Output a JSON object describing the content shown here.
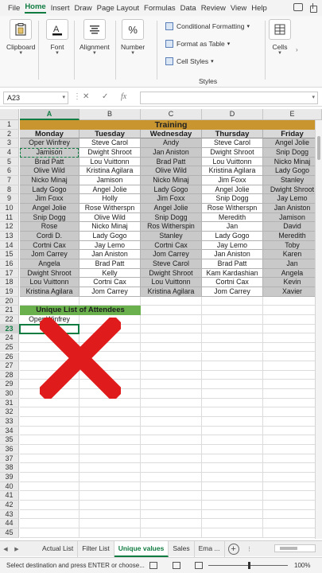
{
  "menu": [
    "File",
    "Home",
    "Insert",
    "Draw",
    "Page Layout",
    "Formulas",
    "Data",
    "Review",
    "View",
    "Help"
  ],
  "menu_active": "Home",
  "ribbon": {
    "clipboard": "Clipboard",
    "font": "Font",
    "alignment": "Alignment",
    "number": "Number",
    "conditional_formatting": "Conditional Formatting",
    "format_as_table": "Format as Table",
    "cell_styles": "Cell Styles",
    "styles": "Styles",
    "cells": "Cells",
    "number_symbol": "%"
  },
  "formula_bar": {
    "name_box": "A23",
    "fx": "fx",
    "value": ""
  },
  "columns": [
    "A",
    "B",
    "C",
    "D",
    "E"
  ],
  "rows": [
    "1",
    "2",
    "3",
    "4",
    "5",
    "6",
    "7",
    "8",
    "9",
    "10",
    "11",
    "12",
    "13",
    "14",
    "15",
    "16",
    "17",
    "18",
    "19",
    "20",
    "21",
    "22",
    "23",
    "24",
    "25",
    "26",
    "27",
    "28",
    "29",
    "30",
    "31",
    "32",
    "33",
    "34",
    "35",
    "36",
    "37",
    "38",
    "39",
    "40",
    "41",
    "42",
    "43",
    "44",
    "45"
  ],
  "title": "Training",
  "headers": [
    "Monday",
    "Tuesday",
    "Wednesday",
    "Thursday",
    "Friday"
  ],
  "table": [
    [
      "Oper Winfrey",
      "Steve Carol",
      "Andy",
      "Steve Carol",
      "Angel Jolie"
    ],
    [
      "Jamison",
      "Dwight Shroot",
      "Jan Aniston",
      "Dwight Shroot",
      "Snip Dogg"
    ],
    [
      "Brad Patt",
      "Lou Vuittonn",
      "Brad Patt",
      "Lou Vuittonn",
      "Nicko Minaj"
    ],
    [
      "Olive Wild",
      "Kristina Agilara",
      "Olive Wild",
      "Kristina Agilara",
      "Lady Gogo"
    ],
    [
      "Nicko Minaj",
      "Jamison",
      "Nicko Minaj",
      "Jim Foxx",
      "Stanley"
    ],
    [
      "Lady Gogo",
      "Angel Jolie",
      "Lady Gogo",
      "Angel Jolie",
      "Dwight Shroot"
    ],
    [
      "Jim Foxx",
      "Holly",
      "Jim Foxx",
      "Snip Dogg",
      "Jay Lemo"
    ],
    [
      "Angel Jolie",
      "Rose Witherspn",
      "Angel Jolie",
      "Rose Witherspn",
      "Jan Aniston"
    ],
    [
      "Snip Dogg",
      "Olive Wild",
      "Snip Dogg",
      "Meredith",
      "Jamison"
    ],
    [
      "Rose",
      "Nicko Minaj",
      "Ros Witherspin",
      "Jan",
      "David"
    ],
    [
      "Cordi D.",
      "Lady Gogo",
      "Stanley",
      "Lady Gogo",
      "Meredith"
    ],
    [
      "Cortni Cax",
      "Jay Lemo",
      "Cortni Cax",
      "Jay Lemo",
      "Toby"
    ],
    [
      "Jom Carrey",
      "Jan Aniston",
      "Jom Carrey",
      "Jan Aniston",
      "Karen"
    ],
    [
      "Angela",
      "Brad Patt",
      "Steve Carol",
      "Brad Patt",
      "Jan"
    ],
    [
      "Dwight Shroot",
      "Kelly",
      "Dwight Shroot",
      "Kam Kardashian",
      "Angela"
    ],
    [
      "Lou Vuittonn",
      "Cortni Cax",
      "Lou Vuittonn",
      "Cortni Cax",
      "Kevin"
    ],
    [
      "Kristina Agilara",
      "Jom Carrey",
      "Kristina Agilara",
      "Jom Carrey",
      "Xavier"
    ]
  ],
  "unique_header": "Unique List of Attendees",
  "a22_value": "Oper Winfrey",
  "sheet_tabs": [
    "Actual List",
    "Filter List",
    "Unique values",
    "Sales",
    "Ema ..."
  ],
  "active_tab": "Unique values",
  "status": {
    "message": "Select destination and press ENTER or choose...",
    "zoom": "100%"
  },
  "overlay_color": "#e01b1b"
}
